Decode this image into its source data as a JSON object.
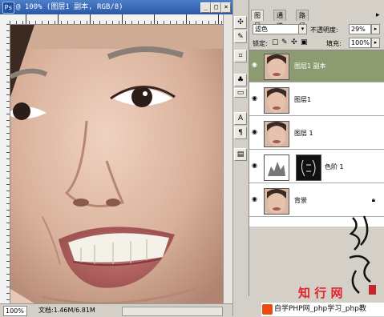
{
  "document_window": {
    "title": "@ 100% (图层1 副本, RGB/8)",
    "buttons": {
      "minimize": "_",
      "maximize": "□",
      "close": "×"
    }
  },
  "status_bar": {
    "zoom": "100%",
    "doc_info": "文档:1.46M/6.81M"
  },
  "tools": [
    {
      "icon": "move-tool-icon",
      "glyph": "✣"
    },
    {
      "icon": "brush-tool-icon",
      "glyph": "✎"
    },
    {
      "icon": "crop-tool-icon",
      "glyph": "⌗"
    },
    {
      "icon": "stamp-tool-icon",
      "glyph": "♣"
    },
    {
      "icon": "text-tool-icon",
      "glyph": "A"
    },
    {
      "icon": "pen-tool-icon",
      "glyph": "¶"
    },
    {
      "icon": "notes-tool-icon",
      "glyph": "▤"
    }
  ],
  "layers_panel": {
    "tabs": [
      "图层",
      "通道",
      "路径"
    ],
    "blend_mode": "滤色",
    "opacity_label": "不透明度:",
    "opacity_value": "29%",
    "lock_label": "锁定:",
    "fill_label": "填充:",
    "fill_value": "100%",
    "layers": [
      {
        "name": "图层1 副本",
        "selected": true,
        "type": "photo"
      },
      {
        "name": "图层1",
        "selected": false,
        "type": "photo"
      },
      {
        "name": "图层 1",
        "selected": false,
        "type": "photo"
      },
      {
        "name": "色阶 1",
        "selected": false,
        "type": "adjustment"
      },
      {
        "name": "背景",
        "selected": false,
        "type": "photo",
        "locked": true
      }
    ]
  },
  "watermark": {
    "brand": "知 行 网",
    "footer": "自学PHP网_php学习_php教"
  }
}
